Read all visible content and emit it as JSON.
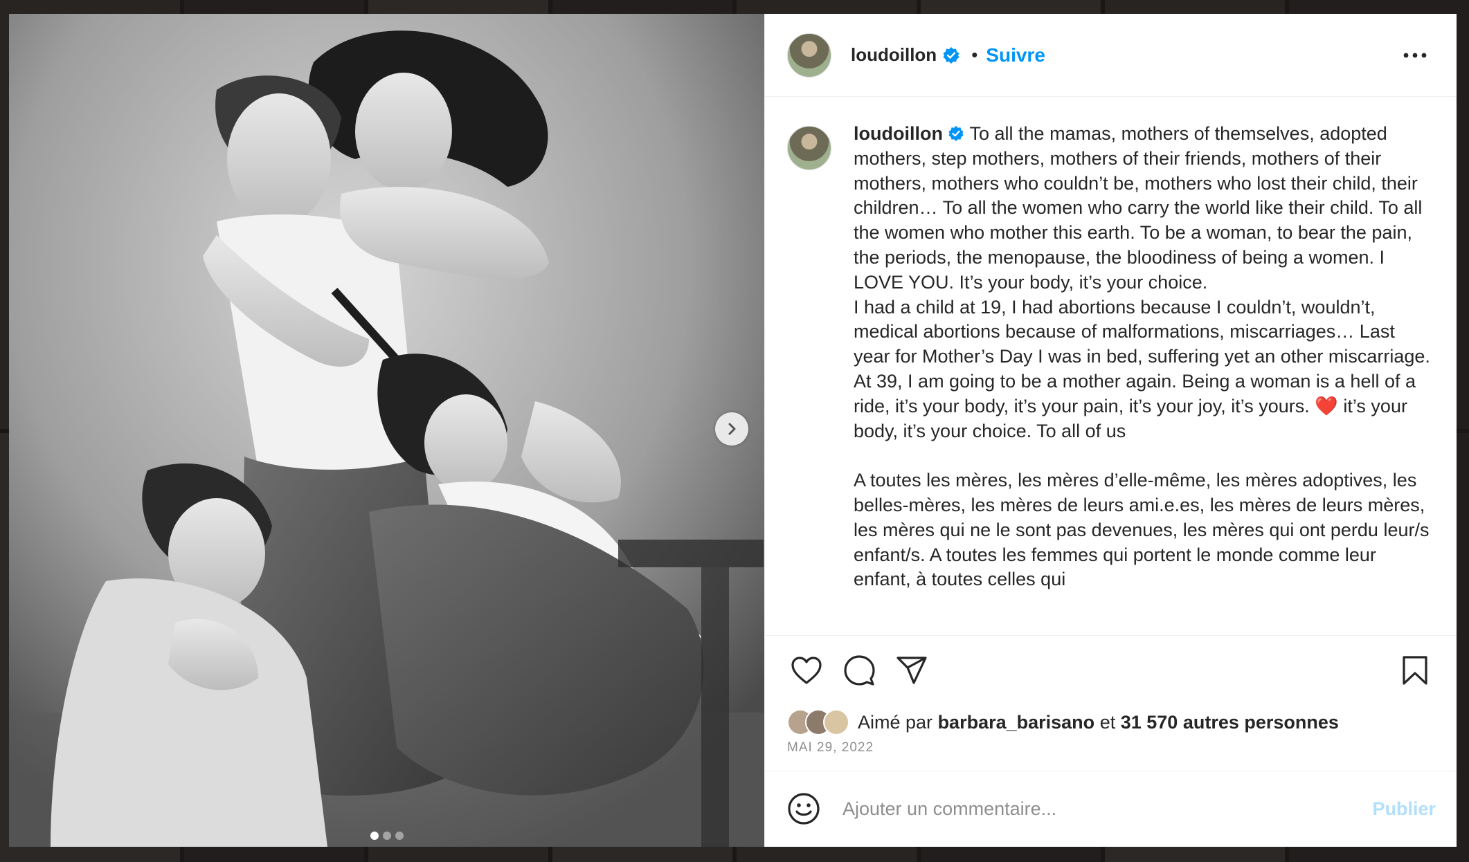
{
  "post": {
    "username": "loudoillon",
    "follow_label": "Suivre",
    "separator": "•",
    "more_icon": "more-horizontal-icon"
  },
  "caption": {
    "username": "loudoillon",
    "text_en_1": "To all the mamas, mothers of themselves, adopted mothers, step mothers, mothers of their friends, mothers of their mothers, mothers who couldn’t be, mothers who lost their child, their children… To all the women who carry the world like their child. To all the women who mother this earth. To be a woman, to bear the pain, the periods, the menopause, the bloodiness of being a women. I LOVE YOU. It’s your body, it’s your choice.\nI had a child at 19, I had abortions because I couldn’t, wouldn’t, medical abortions because of malformations, miscarriages… Last year for Mother’s Day I was in bed, suffering yet an other miscarriage. At 39, I am going to be a mother again. Being a woman is a hell of a ride, it’s your body, it’s your pain, it’s your joy, it’s yours. ",
    "heart_emoji": "❤️",
    "text_en_2": " it’s your body, it’s your choice. To all of us\n\n",
    "text_fr": "A toutes les mères, les mères d’elle-même, les mères adoptives, les belles-mères, les mères de leurs ami.e.es, les mères de leurs mères, les mères qui ne le sont pas devenues, les mères qui ont perdu leur/s enfant/s. A toutes les femmes qui portent le monde comme leur enfant, à toutes celles qui"
  },
  "likes": {
    "prefix": "Aimé par",
    "liked_by_user": "barbara_barisano",
    "conjunction": "et",
    "others": "31 570 autres personnes"
  },
  "date": "MAI 29, 2022",
  "comment_box": {
    "placeholder": "Ajouter un commentaire...",
    "publish_label": "Publier"
  },
  "carousel": {
    "current_index": 1,
    "total": 3
  },
  "colors": {
    "accent": "#0095f6",
    "verified": "#0095f6",
    "publish_disabled": "#b2dffc",
    "text": "#262626",
    "secondary": "#8e8e8e"
  }
}
